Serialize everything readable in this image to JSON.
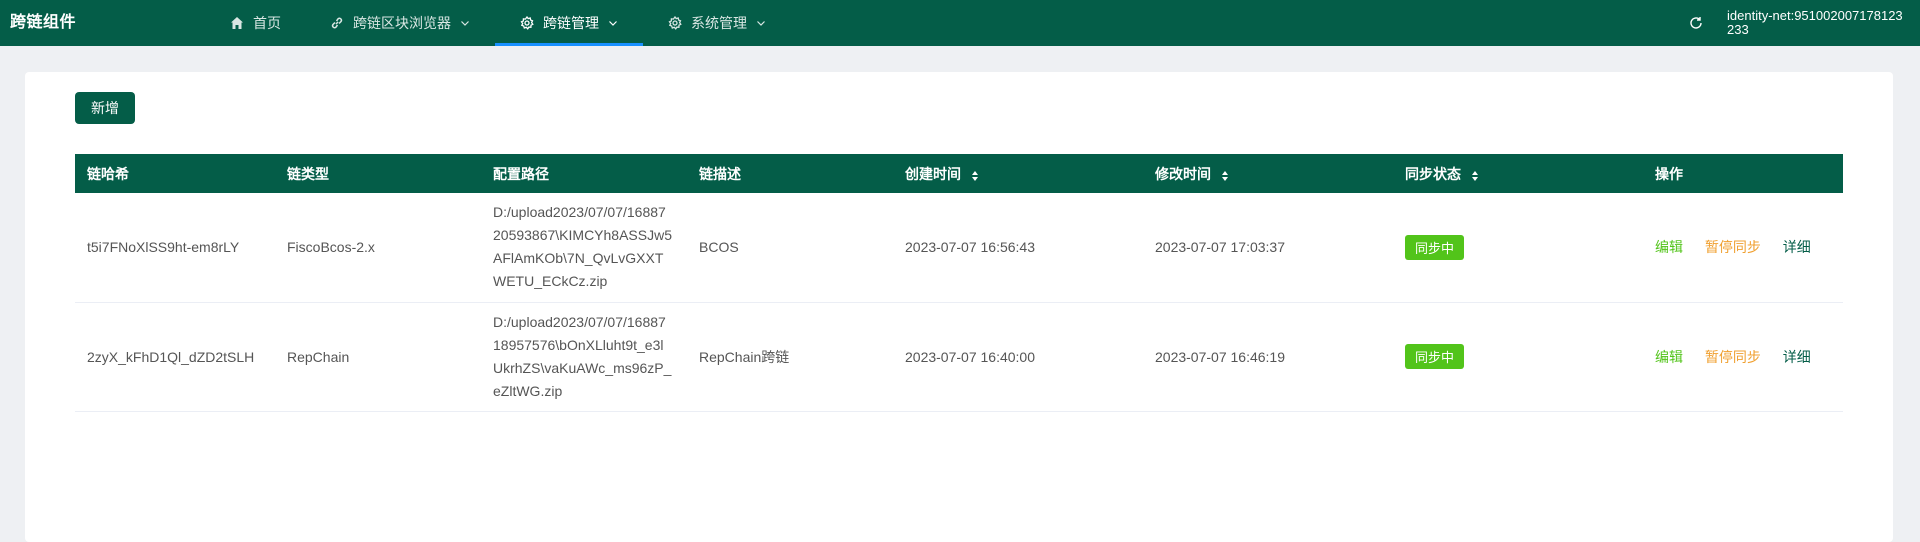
{
  "header": {
    "brand": "跨链组件",
    "nav": [
      {
        "label": "首页",
        "icon": "home-icon",
        "has_dropdown": false,
        "active": false
      },
      {
        "label": "跨链区块浏览器",
        "icon": "link-icon",
        "has_dropdown": true,
        "active": false
      },
      {
        "label": "跨链管理",
        "icon": "gear-icon",
        "has_dropdown": true,
        "active": true
      },
      {
        "label": "系统管理",
        "icon": "gear-icon",
        "has_dropdown": true,
        "active": false
      }
    ],
    "identity": "identity-net:95100200717812323​3"
  },
  "toolbar": {
    "add_label": "新增"
  },
  "table": {
    "columns": [
      "链哈希",
      "链类型",
      "配置路径",
      "链描述",
      "创建时间",
      "修改时间",
      "同步状态",
      "操作"
    ],
    "rows": [
      {
        "hash": "t5i7FNoXlSS9ht-em8rLY",
        "type": "FiscoBcos-2.x",
        "path": "D:/upload2023/07/07/1688720593867\\KIMCYh8ASSJw5AFlAmKOb\\7N_QvLvGXXTWETU_ECkCz.zip",
        "desc": "BCOS",
        "created": "2023-07-07 16:56:43",
        "modified": "2023-07-07 17:03:37",
        "status": "同步中",
        "actions": {
          "edit": "编辑",
          "pause": "暂停同步",
          "detail": "详细"
        }
      },
      {
        "hash": "2zyX_kFhD1Ql_dZD2tSLH",
        "type": "RepChain",
        "path": "D:/upload2023/07/07/1688718957576\\bOnXLluht9t_e3lUkrhZS\\vaKuAWc_ms96zP_eZltWG.zip",
        "desc": "RepChain跨链",
        "created": "2023-07-07 16:40:00",
        "modified": "2023-07-07 16:46:19",
        "status": "同步中",
        "actions": {
          "edit": "编辑",
          "pause": "暂停同步",
          "detail": "详细"
        }
      }
    ]
  },
  "colors": {
    "primary": "#045d48",
    "tab_underline": "#1890ff",
    "status_tag": "#52c41a",
    "edit": "#52c41a",
    "pause": "#f0a030",
    "page_bg": "#eef0f3"
  }
}
